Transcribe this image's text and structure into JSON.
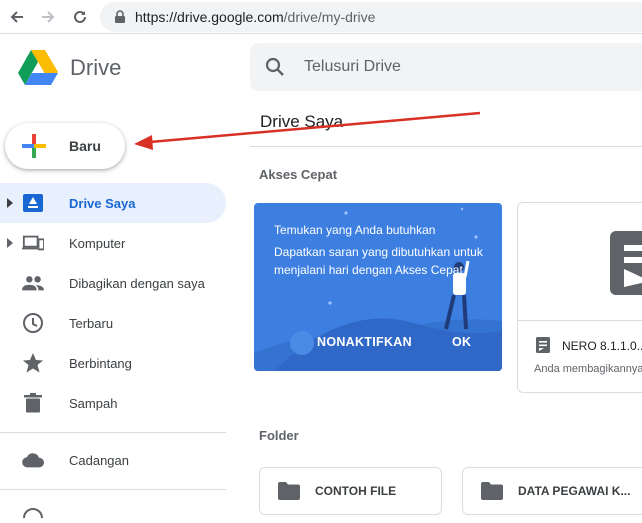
{
  "browser": {
    "url_scheme": "https://",
    "url_host": "drive.google.com",
    "url_path": "/drive/my-drive"
  },
  "header": {
    "brand": "Drive",
    "search_placeholder": "Telusuri Drive"
  },
  "new_button": {
    "label": "Baru"
  },
  "sidebar": {
    "items": [
      {
        "label": "Drive Saya",
        "icon": "my-drive-icon"
      },
      {
        "label": "Komputer",
        "icon": "computers-icon"
      },
      {
        "label": "Dibagikan dengan saya",
        "icon": "shared-icon"
      },
      {
        "label": "Terbaru",
        "icon": "clock-icon"
      },
      {
        "label": "Berbintang",
        "icon": "star-icon"
      },
      {
        "label": "Sampah",
        "icon": "trash-icon"
      }
    ],
    "backup": {
      "label": "Cadangan",
      "icon": "cloud-icon"
    }
  },
  "main": {
    "title": "Drive Saya",
    "quick_access_heading": "Akses Cepat",
    "promo": {
      "title": "Temukan yang Anda butuhkan",
      "body": "Dapatkan saran yang dibutuhkan untuk menjalani hari dengan Akses Cepat",
      "dismiss": "NONAKTIFKAN",
      "ok": "OK"
    },
    "file_card": {
      "name": "NERO 8.1.1.0...",
      "subtitle": "Anda membagikannya"
    },
    "folder_heading": "Folder",
    "folders": [
      "CONTOH FILE",
      "DATA PEGAWAI K..."
    ]
  },
  "colors": {
    "accent": "#1a73e8",
    "active_bg": "#e8f0fe",
    "promo_bg": "#3d7fe0",
    "annotation_arrow": "#d93025"
  }
}
